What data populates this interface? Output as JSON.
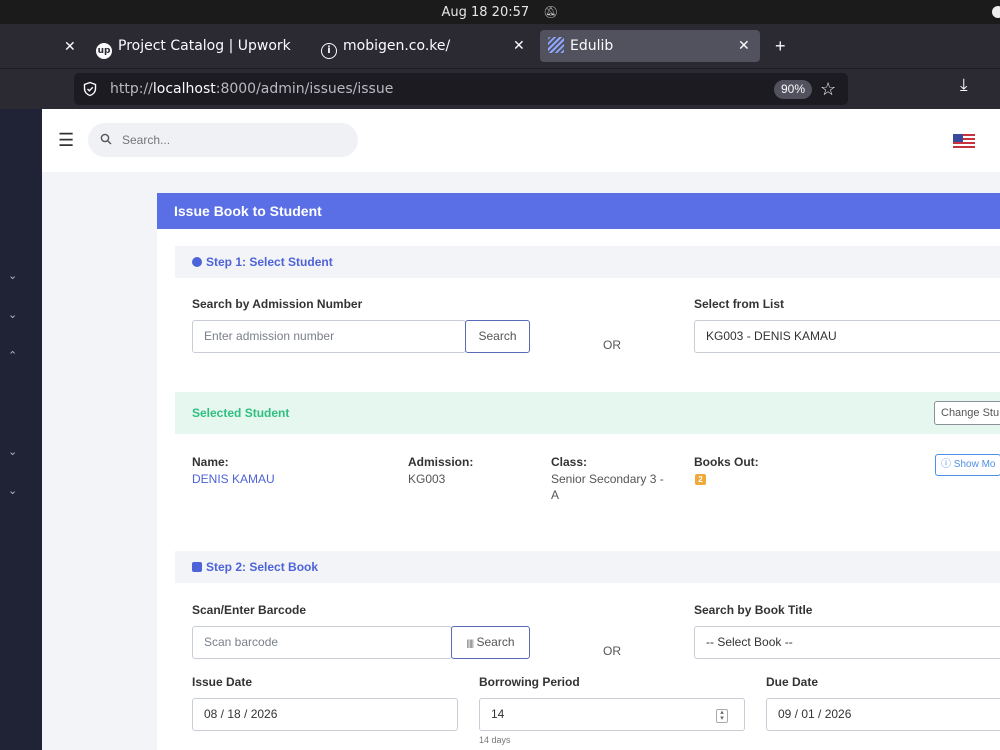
{
  "os": {
    "clock": "Aug 18  20:57",
    "bell_icon": "bell-off-icon"
  },
  "browser": {
    "tabs": [
      {
        "label": "Project Catalog | Upwork",
        "favicon": "up"
      },
      {
        "label": "mobigen.co.ke/",
        "favicon": "info-icon"
      },
      {
        "label": "Edulib",
        "favicon": "edulib-icon",
        "active": true
      }
    ],
    "url_prefix": "http://",
    "url_host": "localhost",
    "url_path": ":8000/admin/issues/issue",
    "zoom": "90%"
  },
  "topbar": {
    "search_placeholder": "Search..."
  },
  "page": {
    "title": "Issue Book to Student",
    "step1": {
      "title": "Step 1: Select Student",
      "admission_label": "Search by Admission Number",
      "admission_placeholder": "Enter admission number",
      "search_button": "Search",
      "or": "OR",
      "list_label": "Select from List",
      "list_value": "KG003 - DENIS KAMAU"
    },
    "selected": {
      "title": "Selected Student",
      "change_button": "Change Stu",
      "name_label": "Name:",
      "name_value": "DENIS KAMAU",
      "admission_label": "Admission:",
      "admission_value": "KG003",
      "class_label": "Class:",
      "class_value_1": "Senior Secondary 3 -",
      "class_value_2": "A",
      "books_out_label": "Books Out:",
      "books_out_value": "2",
      "show_more_button": "Show Mo"
    },
    "step2": {
      "title": "Step 2: Select Book",
      "barcode_label": "Scan/Enter Barcode",
      "barcode_placeholder": "Scan barcode",
      "barcode_button": "Search",
      "or": "OR",
      "title_label": "Search by Book Title",
      "title_select": "-- Select Book --",
      "issue_date_label": "Issue Date",
      "issue_date_value": "08 / 18 / 2026",
      "period_label": "Borrowing Period",
      "period_value": "14",
      "period_hint": "14 days",
      "due_date_label": "Due Date",
      "due_date_value": "09 / 01 / 2026"
    }
  },
  "colors": {
    "primary": "#5a6ee6",
    "success": "#2fbf7f",
    "sidebar": "#1f2335",
    "warning": "#f0a93b"
  }
}
